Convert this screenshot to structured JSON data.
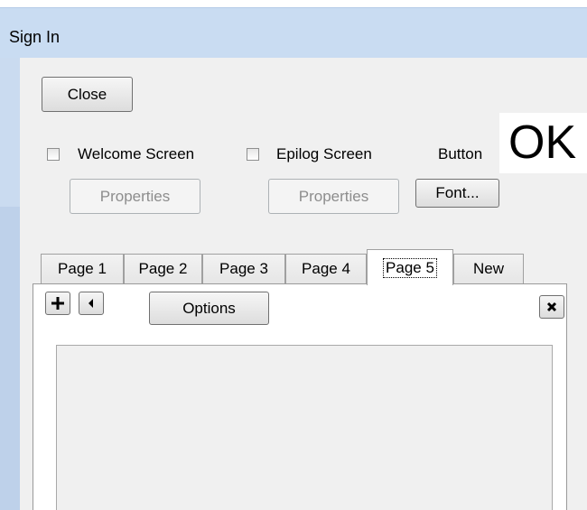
{
  "window": {
    "title": "Sign In"
  },
  "toolbar": {
    "close_label": "Close"
  },
  "options": {
    "welcome_label": "Welcome Screen",
    "epilog_label": "Epilog Screen",
    "welcome_properties_label": "Properties",
    "epilog_properties_label": "Properties",
    "button_label": "Button",
    "font_label": "Font...",
    "preview_text": "OK"
  },
  "tabs": [
    {
      "label": "Page 1"
    },
    {
      "label": "Page 2"
    },
    {
      "label": "Page 3"
    },
    {
      "label": "Page 4"
    },
    {
      "label": "Page 5"
    },
    {
      "label": "New"
    }
  ],
  "active_tab": "Page 5",
  "page": {
    "options_label": "Options"
  },
  "icons": {
    "add": "plus-icon",
    "back": "left-arrow-icon",
    "delete": "close-icon"
  }
}
